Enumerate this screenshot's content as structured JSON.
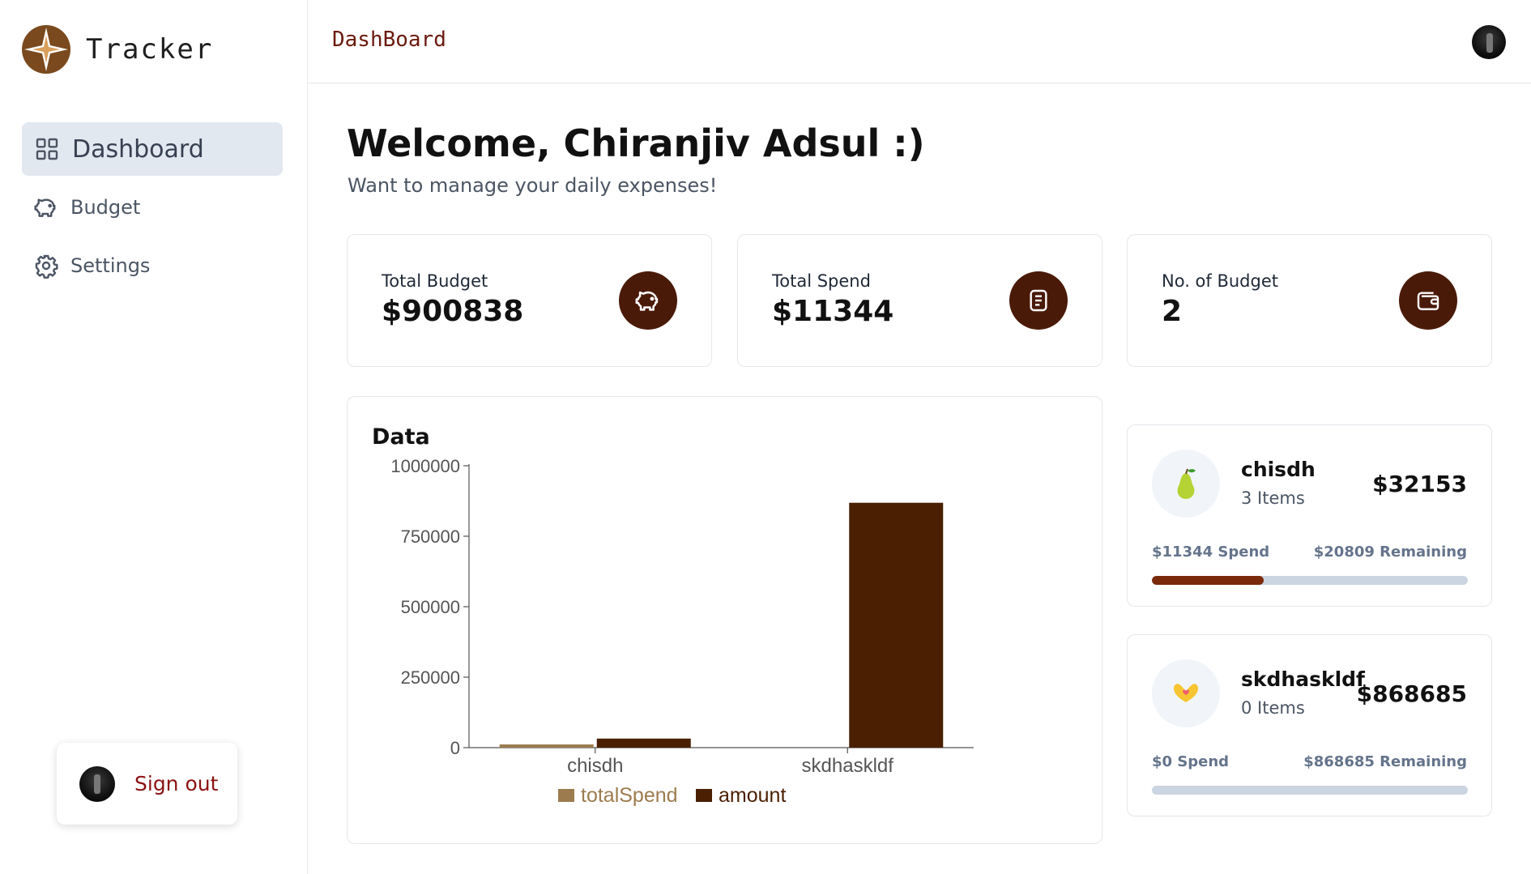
{
  "app": {
    "name": "Tracker"
  },
  "sidebar": {
    "items": [
      {
        "label": "Dashboard",
        "icon": "dashboard-grid-icon",
        "active": true
      },
      {
        "label": "Budget",
        "icon": "piggy-bank-icon",
        "active": false
      },
      {
        "label": "Settings",
        "icon": "gear-icon",
        "active": false
      }
    ],
    "signout_label": "Sign out"
  },
  "header": {
    "title": "DashBoard"
  },
  "main": {
    "welcome": "Welcome, Chiranjiv Adsul :)",
    "subtitle": "Want to manage your daily expenses!",
    "stats": [
      {
        "label": "Total Budget",
        "value": "$900838",
        "icon": "piggy-bank-icon"
      },
      {
        "label": "Total Spend",
        "value": "$11344",
        "icon": "receipt-icon"
      },
      {
        "label": "No. of Budget",
        "value": "2",
        "icon": "wallet-icon"
      }
    ],
    "budgets": [
      {
        "name": "chisdh",
        "items": "3 Items",
        "amount": "$32153",
        "spend": "$11344 Spend",
        "remaining": "$20809 Remaining",
        "emoji": "pear",
        "progress": 0.353
      },
      {
        "name": "skdhaskldf",
        "items": "0 Items",
        "amount": "$868685",
        "spend": "$0 Spend",
        "remaining": "$868685 Remaining",
        "emoji": "heart-hands",
        "progress": 0
      }
    ]
  },
  "colors": {
    "accent": "#4a1a08",
    "totalSpend": "#9c7c4e",
    "amount": "#4a1f02",
    "progress": "#7a2a0a",
    "signout": "#8b1111"
  },
  "chart_data": {
    "type": "bar",
    "title": "Data",
    "categories": [
      "chisdh",
      "skdhaskldf"
    ],
    "series": [
      {
        "name": "totalSpend",
        "values": [
          11344,
          0
        ]
      },
      {
        "name": "amount",
        "values": [
          32153,
          868685
        ]
      }
    ],
    "ylim": [
      0,
      1000000
    ],
    "yticks": [
      "0",
      "250000",
      "500000",
      "750000",
      "1000000"
    ],
    "legend_position": "bottom"
  }
}
